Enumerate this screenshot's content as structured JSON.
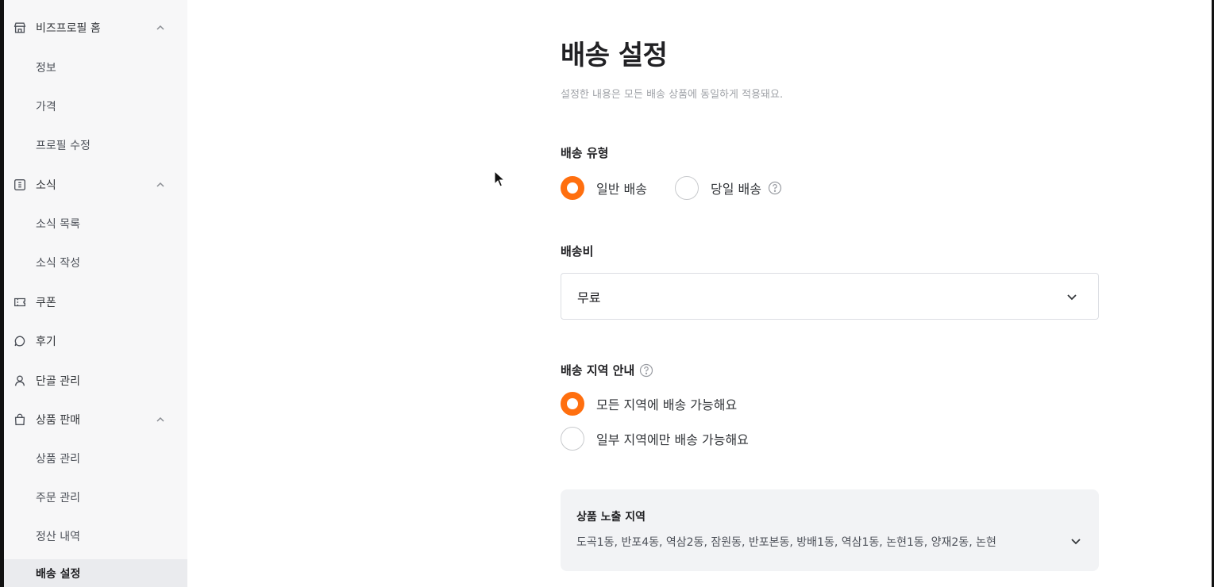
{
  "sidebar": {
    "items": [
      {
        "label": "비즈프로필 홈",
        "icon": "store-icon",
        "type": "parent",
        "expanded": true
      },
      {
        "label": "정보",
        "type": "child"
      },
      {
        "label": "가격",
        "type": "child"
      },
      {
        "label": "프로필 수정",
        "type": "child"
      },
      {
        "label": "소식",
        "icon": "news-icon",
        "type": "parent",
        "expanded": true
      },
      {
        "label": "소식 목록",
        "type": "child"
      },
      {
        "label": "소식 작성",
        "type": "child"
      },
      {
        "label": "쿠폰",
        "icon": "ticket-icon",
        "type": "parent"
      },
      {
        "label": "후기",
        "icon": "chat-bubble-icon",
        "type": "parent"
      },
      {
        "label": "단골 관리",
        "icon": "person-icon",
        "type": "parent"
      },
      {
        "label": "상품 판매",
        "icon": "shopping-bag-icon",
        "type": "parent",
        "expanded": true
      },
      {
        "label": "상품 관리",
        "type": "child"
      },
      {
        "label": "주문 관리",
        "type": "child"
      },
      {
        "label": "정산 내역",
        "type": "child"
      },
      {
        "label": "배송 설정",
        "type": "child",
        "active": true
      }
    ]
  },
  "main": {
    "title": "배송 설정",
    "description": "설정한 내용은 모든 배송 상품에 동일하게 적용돼요.",
    "delivery_type": {
      "label": "배송 유형",
      "options": [
        {
          "label": "일반 배송",
          "checked": true
        },
        {
          "label": "당일 배송",
          "checked": false
        }
      ]
    },
    "shipping_fee": {
      "label": "배송비",
      "selected": "무료"
    },
    "delivery_area": {
      "label": "배송 지역 안내",
      "options": [
        {
          "label": "모든 지역에 배송 가능해요",
          "checked": true
        },
        {
          "label": "일부 지역에만 배송 가능해요",
          "checked": false
        }
      ]
    },
    "exposure_region": {
      "title": "상품 노출 지역",
      "list": "도곡1동, 반포4동, 역삼2동, 잠원동, 반포본동, 방배1동, 역삼1동, 논현1동, 양재2동, 논현"
    }
  },
  "colors": {
    "accent": "#ff6f0f",
    "sidebar_bg": "#f7f7f8",
    "active_bg": "#eaebee"
  }
}
